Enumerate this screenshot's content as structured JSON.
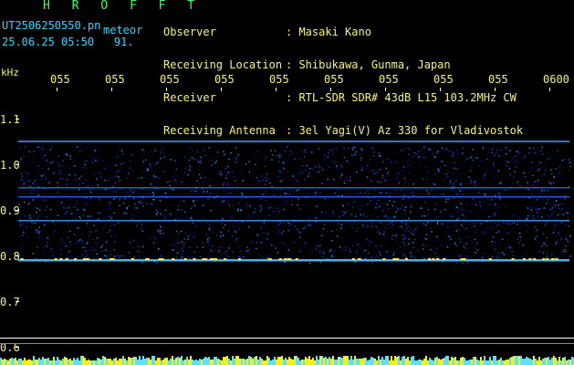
{
  "header": {
    "station": "H R O F F T",
    "filename": "UT2506250550.pn",
    "category": "meteor",
    "timestamp": "25.06.25 05:50",
    "count": "91."
  },
  "info": {
    "labels": [
      "Observer",
      "Receiving Location",
      "Receiver",
      "Receiving Antenna"
    ],
    "values": [
      ": Masaki Kano",
      ": Shibukawa, Gunma, Japan",
      ": RTL-SDR SDR# 43dB L15 103.2MHz CW",
      ": 3el Yagi(V) Az 330 for Vladivostok"
    ]
  },
  "axis": {
    "y_unit": "kHz",
    "y_ticks": [
      "1.1",
      "1.0",
      "0.9",
      "0.8",
      "0.7",
      "0.6"
    ],
    "x_ticks": [
      "055",
      "055",
      "055",
      "055",
      "055",
      "055",
      "055",
      "055",
      "055",
      "0600"
    ]
  },
  "colors": {
    "background": "#000000",
    "title": "#3cff5a",
    "info_text": "#f4f47a",
    "file_text": "#33d6ff",
    "axis_line": "#ffffff",
    "spectrum_low": "#0a1a8c",
    "spectrum_high": "#ffff00"
  }
}
